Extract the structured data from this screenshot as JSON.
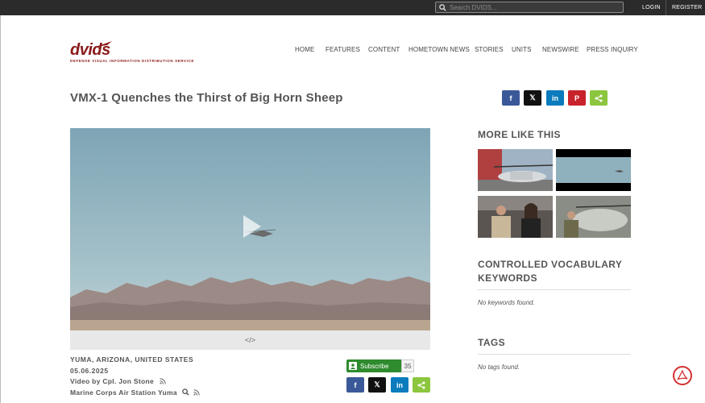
{
  "topbar": {
    "search_placeholder": "Search DVIDS...",
    "login": "LOGIN",
    "register": "REGISTER"
  },
  "logo": {
    "word": "dvids",
    "tagline": "DEFENSE VISUAL INFORMATION DISTRIBUTION SERVICE"
  },
  "nav": [
    "HOME",
    "FEATURES",
    "CONTENT",
    "HOMETOWN NEWS",
    "STORIES",
    "UNITS",
    "NEWSWIRE",
    "PRESS INQUIRY"
  ],
  "article": {
    "title": "VMX-1 Quenches the Thirst of Big Horn Sheep",
    "location": "YUMA, ARIZONA, UNITED STATES",
    "date": "05.06.2025",
    "byline": "Video by Cpl. Jon Stone",
    "unit": "Marine Corps Air Station Yuma"
  },
  "share_buttons": [
    {
      "icon": "facebook-icon",
      "glyph": "f",
      "color": "#3b5998"
    },
    {
      "icon": "x-icon",
      "glyph": "𝕏",
      "color": "#111111"
    },
    {
      "icon": "linkedin-icon",
      "glyph": "in",
      "color": "#0a7bbd"
    },
    {
      "icon": "pinterest-icon",
      "glyph": "P",
      "color": "#c8232c"
    },
    {
      "icon": "share-icon",
      "glyph": "<",
      "color": "#8cc63f"
    }
  ],
  "video": {
    "embed_glyph": "</>"
  },
  "subscribe": {
    "label": "Subscribe",
    "count": "35"
  },
  "sidebar": {
    "more_like_this": "MORE LIKE THIS",
    "keywords_heading": "CONTROLLED VOCABULARY KEYWORDS",
    "keywords_empty": "No keywords found.",
    "tags_heading": "TAGS",
    "tags_empty": "No tags found."
  }
}
